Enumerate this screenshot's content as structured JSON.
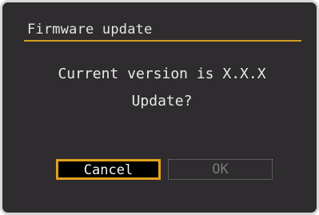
{
  "dialog": {
    "title": "Firmware update",
    "message_line_1": "Current version is X.X.X",
    "message_line_2": "Update?"
  },
  "buttons": {
    "cancel_label": "Cancel",
    "ok_label": "OK",
    "selected": "Cancel",
    "ok_enabled": false
  },
  "colors": {
    "background": "#2e2c2e",
    "accent": "#e3a11c",
    "text": "#e9e9e9",
    "disabled_text": "#7a7a7a"
  }
}
